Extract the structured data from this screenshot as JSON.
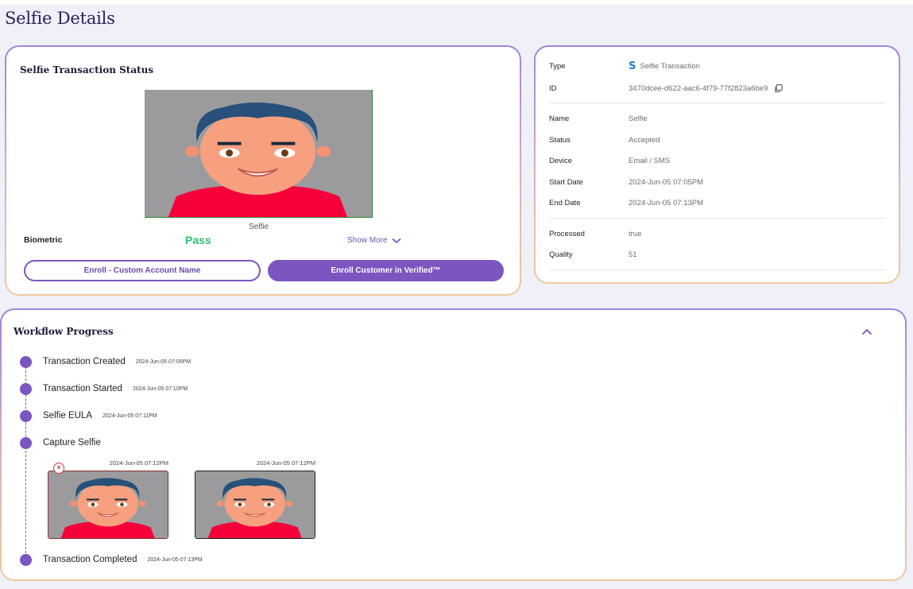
{
  "page": {
    "title": "Selfie Details"
  },
  "status_card": {
    "title": "Selfie Transaction Status",
    "image_caption": "Selfie",
    "biometric_label": "Biometric",
    "biometric_value": "Pass",
    "show_more": "Show More",
    "enroll_custom_label": "Enroll - Custom Account Name",
    "enroll_verified_label": "Enroll Customer in Verified™"
  },
  "info_card": {
    "type_label": "Type",
    "type_value": "Selfie Transaction",
    "type_icon": "s-brand-icon",
    "id_label": "ID",
    "id_value": "3470dcee-d622-aac6-4f79-77f2823a6be9",
    "rows": [
      {
        "label": "Name",
        "value": "Selfie"
      },
      {
        "label": "Status",
        "value": "Accepted"
      },
      {
        "label": "Device",
        "value": "Email / SMS"
      },
      {
        "label": "Start Date",
        "value": "2024-Jun-05 07:05PM"
      },
      {
        "label": "End Date",
        "value": "2024-Jun-05 07:13PM"
      }
    ],
    "rows2": [
      {
        "label": "Processed",
        "value": "true"
      },
      {
        "label": "Quality",
        "value": "51"
      }
    ]
  },
  "workflow": {
    "title": "Workflow Progress",
    "steps": [
      {
        "label": "Transaction Created",
        "time": "2024-Jun-05 07:05PM"
      },
      {
        "label": "Transaction Started",
        "time": "2024-Jun-05 07:10PM"
      },
      {
        "label": "Selfie EULA",
        "time": "2024-Jun-05 07:11PM"
      },
      {
        "label": "Capture Selfie",
        "time": ""
      },
      {
        "label": "Transaction Completed",
        "time": "2024-Jun-05 07:13PM"
      }
    ],
    "captures": [
      {
        "time": "2024-Jun-05 07:12PM",
        "status": "failed"
      },
      {
        "time": "2024-Jun-05 07:12PM",
        "status": "ok"
      }
    ]
  },
  "colors": {
    "accent": "#7b55c0",
    "pass": "#2fbf71",
    "fail": "#dd3333",
    "brand_s": "#1f7bd8"
  }
}
